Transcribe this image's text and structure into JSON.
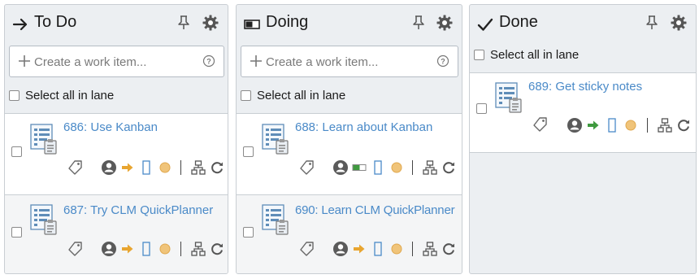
{
  "colors": {
    "link": "#4a8ac8",
    "lane_bg": "#eceff2",
    "border": "#c9ced3",
    "progress_orange": "#e8a530",
    "progress_green": "#3f9a3f"
  },
  "lanes": [
    {
      "title": "To Do",
      "icon": "arrow-right-icon",
      "create_placeholder": "Create a work item...",
      "select_all_label": "Select all in lane",
      "cards": [
        {
          "title": "686: Use Kanban",
          "status_arrow": "orange-arrow-icon"
        },
        {
          "title": "687: Try CLM QuickPlanner",
          "status_arrow": "orange-arrow-icon"
        }
      ]
    },
    {
      "title": "Doing",
      "icon": "progress-bar-icon",
      "create_placeholder": "Create a work item...",
      "select_all_label": "Select all in lane",
      "cards": [
        {
          "title": "688: Learn about Kanban",
          "status_arrow": "progress-bar-icon"
        },
        {
          "title": "690: Learn CLM QuickPlanner",
          "status_arrow": "orange-arrow-icon"
        }
      ]
    },
    {
      "title": "Done",
      "icon": "checkmark-icon",
      "select_all_label": "Select all in lane",
      "cards": [
        {
          "title": "689: Get sticky notes",
          "status_arrow": "green-arrow-icon"
        }
      ]
    }
  ]
}
